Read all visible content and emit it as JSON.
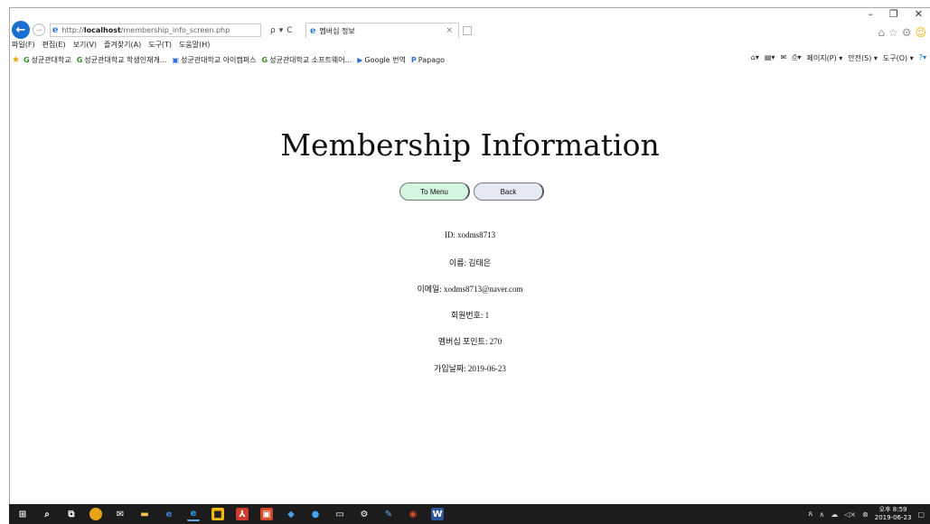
{
  "browser": {
    "url_prefix": "http://",
    "url_host": "localhost",
    "url_path": "/membership_info_screen.php",
    "search_icon_glyph": "ρ",
    "dropdown_glyph": "▾",
    "refresh_glyph": "C",
    "tab_title": "멤버십 정보",
    "tab_close": "×",
    "win_minimize": "–",
    "win_restore": "❐",
    "win_close": "✕"
  },
  "menu": [
    "파일(F)",
    "편집(E)",
    "보기(V)",
    "즐겨찾기(A)",
    "도구(T)",
    "도움말(H)"
  ],
  "favorites": [
    {
      "icon": "G",
      "label": "성균관대학교"
    },
    {
      "icon": "G",
      "label": "성균관대학교 학생인재개..."
    },
    {
      "icon": "▣",
      "label": "성균관대학교 아이캠퍼스"
    },
    {
      "icon": "G",
      "label": "성균관대학교 소프트웨어..."
    },
    {
      "icon": "▶",
      "label": "Google 번역"
    },
    {
      "icon": "P",
      "label": "Papago"
    }
  ],
  "command_bar": {
    "page": "페이지(P) ▾",
    "safety": "안전(S) ▾",
    "tools": "도구(O) ▾"
  },
  "page": {
    "title": "Membership Information",
    "to_menu_label": "To Menu",
    "back_label": "Back",
    "fields": [
      "ID: xodms8713",
      "이름: 김태은",
      "이메일: xodms8713@naver.com",
      "회원번호: 1",
      "멤버십 포인트: 270",
      "가입날짜: 2019-06-23"
    ]
  },
  "taskbar": {
    "time": "오후 8:59",
    "date": "2019-06-23"
  }
}
